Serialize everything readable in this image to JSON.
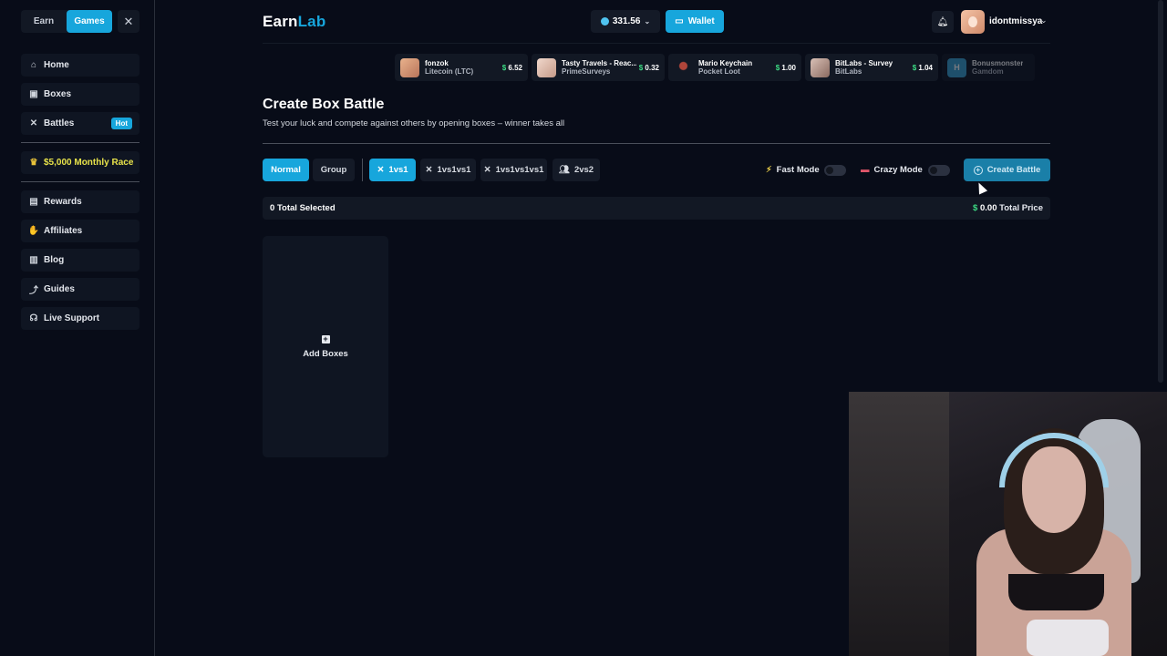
{
  "sidebar": {
    "mode_switch": {
      "earn": "Earn",
      "games": "Games"
    },
    "close_icon": "close-icon",
    "items_top": [
      {
        "label": "Home",
        "icon": "home-icon"
      },
      {
        "label": "Boxes",
        "icon": "box-icon"
      },
      {
        "label": "Battles",
        "icon": "swords-icon",
        "badge": "Hot"
      }
    ],
    "race": {
      "label": "$5,000 Monthly Race",
      "icon": "trophy-icon"
    },
    "items_bottom": [
      {
        "label": "Rewards",
        "icon": "gift-icon"
      },
      {
        "label": "Affiliates",
        "icon": "hand-coin-icon"
      },
      {
        "label": "Blog",
        "icon": "blog-icon"
      },
      {
        "label": "Guides",
        "icon": "route-icon"
      },
      {
        "label": "Live Support",
        "icon": "headset-icon"
      }
    ]
  },
  "header": {
    "logo_earn": "Earn",
    "logo_lab": "Lab",
    "balance": "331.56",
    "wallet_label": "Wallet",
    "username": "idontmissya"
  },
  "feed": [
    {
      "title": "fonzok",
      "subtitle": "Litecoin (LTC)",
      "currency": "$",
      "amount": "6.52"
    },
    {
      "title": "Tasty Travels - Reac...",
      "subtitle": "PrimeSurveys",
      "currency": "$",
      "amount": "0.32"
    },
    {
      "title": "Mario Keychain",
      "subtitle": "Pocket Loot",
      "currency": "$",
      "amount": "1.00"
    },
    {
      "title": "BitLabs - Survey",
      "subtitle": "BitLabs",
      "currency": "$",
      "amount": "1.04"
    },
    {
      "title": "Bonusmonster",
      "subtitle": "Gamdom",
      "currency": "",
      "amount": "",
      "thumb_letter": "H"
    }
  ],
  "page": {
    "title": "Create Box Battle",
    "subtitle": "Test your luck and compete against others by opening boxes – winner takes all"
  },
  "controls": {
    "normal": "Normal",
    "group": "Group",
    "modes": [
      "1vs1",
      "1vs1vs1",
      "1vs1vs1vs1",
      "2vs2"
    ],
    "fast_mode": "Fast Mode",
    "crazy_mode": "Crazy Mode",
    "create_battle": "Create Battle"
  },
  "summary": {
    "selected_count": "0",
    "selected_label": "Total Selected",
    "currency": "$",
    "price": "0.00",
    "price_label": "Total Price"
  },
  "add_boxes": {
    "label": "Add Boxes"
  },
  "colors": {
    "accent": "#17a6dc",
    "money": "#3ddc84",
    "background": "#080c18"
  }
}
